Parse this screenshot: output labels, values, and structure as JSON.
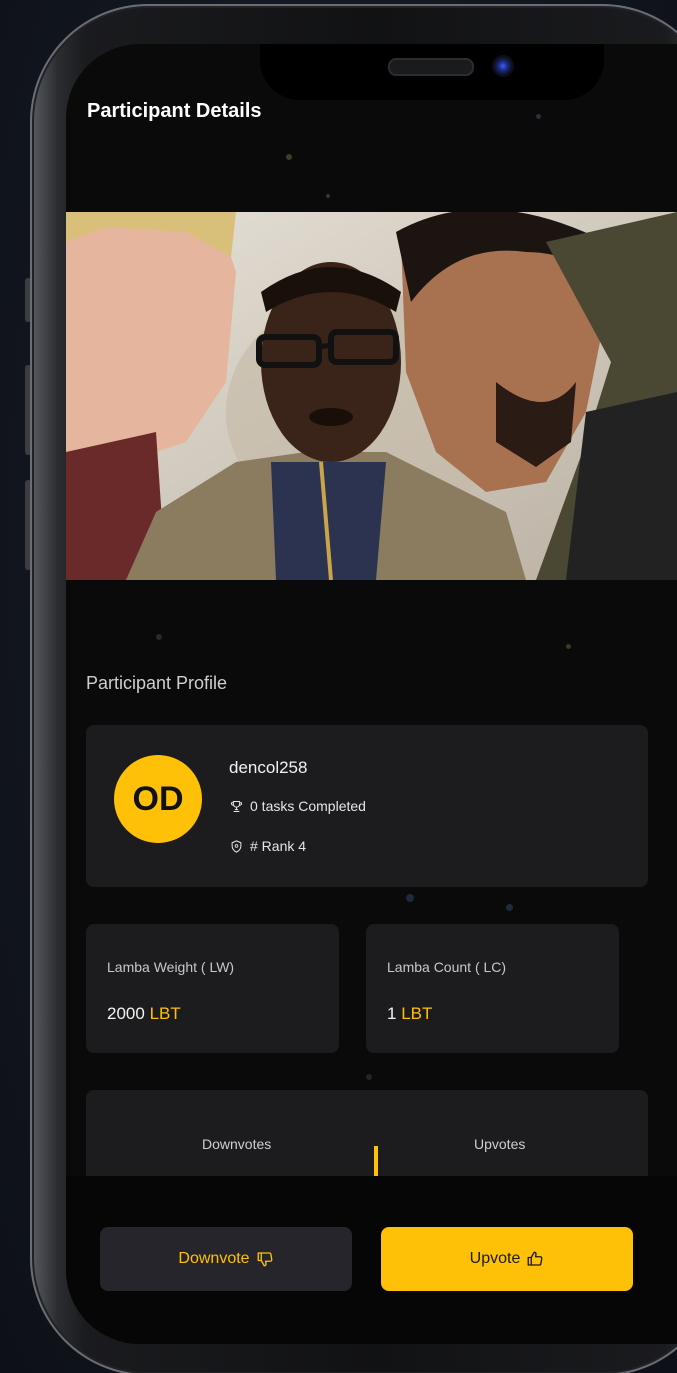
{
  "header": {
    "title": "Participant Details"
  },
  "profile": {
    "section_title": "Participant Profile",
    "avatar_initials": "OD",
    "username": "dencol258",
    "tasks_completed": "0 tasks Completed",
    "rank": "# Rank 4"
  },
  "stats": {
    "weight": {
      "label": "Lamba Weight ( LW)",
      "value": "2000",
      "unit": "LBT"
    },
    "count": {
      "label": "Lamba Count ( LC)",
      "value": "1",
      "unit": "LBT"
    }
  },
  "votes": {
    "downvotes_label": "Downvotes",
    "upvotes_label": "Upvotes"
  },
  "actions": {
    "downvote_label": "Downvote",
    "upvote_label": "Upvote"
  },
  "colors": {
    "accent": "#ffc107",
    "background": "#0a0a0b",
    "card": "#1c1c1e"
  },
  "icons": [
    "trophy-icon",
    "shield-icon",
    "thumbs-down-icon",
    "thumbs-up-icon"
  ]
}
